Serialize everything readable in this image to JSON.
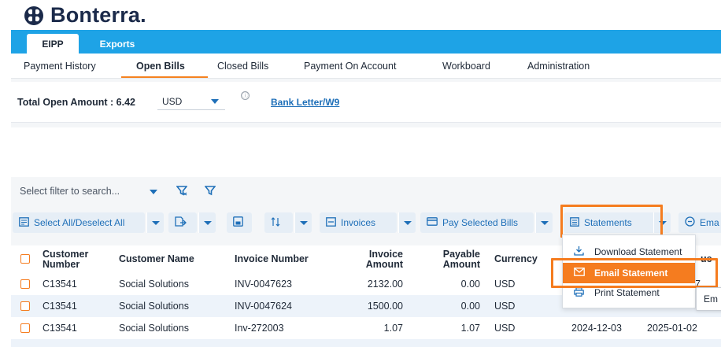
{
  "brand": {
    "name": "Bonterra."
  },
  "top_nav": {
    "tabs": [
      "EIPP",
      "Exports"
    ]
  },
  "sub_nav": {
    "tabs": [
      "Payment History",
      "Open Bills",
      "Closed Bills",
      "Payment On Account",
      "Workboard",
      "Administration"
    ],
    "active": "Open Bills"
  },
  "summary": {
    "label": "Total Open Amount : 6.42",
    "currency": "USD",
    "info_icon": "ⓘ",
    "bank_link": "Bank Letter/W9"
  },
  "filter": {
    "placeholder": "Select filter to search..."
  },
  "toolbar": {
    "select_all": "Select All/Deselect All",
    "invoices": "Invoices",
    "pay_selected": "Pay Selected Bills",
    "statements": "Statements",
    "email_cut": "Ema"
  },
  "statements_menu": {
    "items": [
      "Download Statement",
      "Email Statement",
      "Print Statement"
    ],
    "active": "Email Statement"
  },
  "tooltip": {
    "text": "Em"
  },
  "table": {
    "headers": {
      "customer_number": [
        "Customer",
        "Number"
      ],
      "customer_name": "Customer Name",
      "invoice_number": "Invoice Number",
      "invoice_amount": [
        "Invoice",
        "Amount"
      ],
      "payable_amount": [
        "Payable",
        "Amount"
      ],
      "currency": "Currency",
      "due_partial": "ue"
    },
    "rows": [
      {
        "customer_number": "C13541",
        "customer_name": "Social Solutions",
        "invoice_number": "INV-0047623",
        "invoice_amount": "2132.00",
        "payable_amount": "0.00",
        "currency": "USD",
        "date1": "",
        "date2": "07"
      },
      {
        "customer_number": "C13541",
        "customer_name": "Social Solutions",
        "invoice_number": "INV-0047624",
        "invoice_amount": "1500.00",
        "payable_amount": "0.00",
        "currency": "USD",
        "date1": "",
        "date2": ""
      },
      {
        "customer_number": "C13541",
        "customer_name": "Social Solutions",
        "invoice_number": "Inv-272003",
        "invoice_amount": "1.07",
        "payable_amount": "1.07",
        "currency": "USD",
        "date1": "2024-12-03",
        "date2": "2025-01-02"
      }
    ]
  },
  "colors": {
    "brand_blue": "#1ea3e6",
    "accent_orange": "#f57c1f",
    "link_blue": "#1e6fb8"
  }
}
